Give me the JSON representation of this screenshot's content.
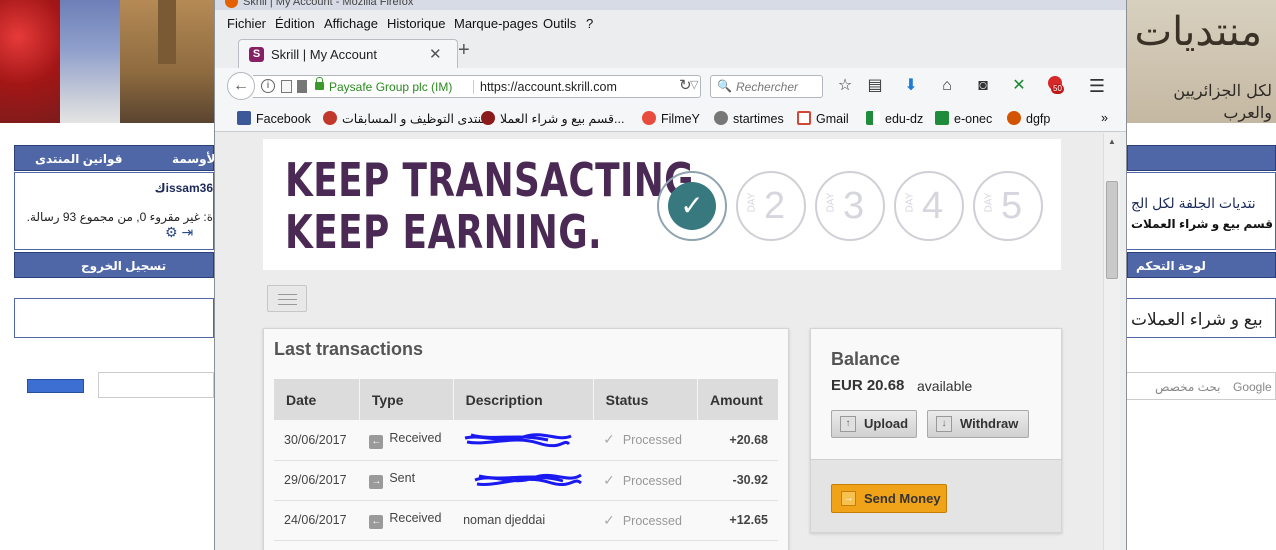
{
  "background": {
    "logo_big": "منتديات",
    "logo_small": "لكل الجزائريين والعرب",
    "forum_rules": "قوانين المنتدى",
    "medals": "الأوسمة",
    "username": "issam36",
    "welcome_prefix": "ك",
    "stats_text": "ة: غير مقروء 0, من مجموع 93 رسالة.",
    "logout": "تسجيل الخروج",
    "control_panel": "لوحة التحكم",
    "right_title": "نتديات الجلفة لكل الج",
    "right_subtitle": "قسم بيع و شراء العملات",
    "right_heading": "بيع و شراء العملات",
    "google_search": "بحث مخصص",
    "google_label": "Google"
  },
  "browser": {
    "window_title": "Skrill | My Account - Mozilla Firefox",
    "menus": [
      "Fichier",
      "Édition",
      "Affichage",
      "Historique",
      "Marque-pages",
      "Outils",
      "?"
    ],
    "tab_title": "Skrill | My Account",
    "tab_favicon": "S",
    "org": "Paysafe Group plc (IM)",
    "url": "https://account.skrill.com",
    "search_placeholder": "Rechercher",
    "badge": "50",
    "bookmarks": [
      "Facebook",
      "منتدى التوظيف و المسابقات",
      "قسم بيع و شراء العملا...",
      "FilmeY",
      "startimes",
      "Gmail",
      "edu-dz",
      "e-onec",
      "dgfp"
    ],
    "bookmark_colors": [
      "#3b5998",
      "#c0392b",
      "#8b1a1a",
      "#e74c3c",
      "#777777",
      "#d44638",
      "#1e8c3a",
      "#1e8c3a",
      "#d35400"
    ]
  },
  "promo": {
    "line1": "KEEP TRANSACTING.",
    "line2": "KEEP EARNING.",
    "day_label": "DAY",
    "days": [
      "2",
      "3",
      "4",
      "5"
    ]
  },
  "transactions": {
    "title": "Last transactions",
    "columns": [
      "Date",
      "Type",
      "Description",
      "Status",
      "Amount"
    ],
    "rows": [
      {
        "date": "30/06/2017",
        "type": "Received",
        "description": "",
        "status": "Processed",
        "amount": "+20.68"
      },
      {
        "date": "29/06/2017",
        "type": "Sent",
        "description": "",
        "status": "Processed",
        "amount": "-30.92"
      },
      {
        "date": "24/06/2017",
        "type": "Received",
        "description": "noman djeddai",
        "status": "Processed",
        "amount": "+12.65"
      }
    ]
  },
  "balance": {
    "title": "Balance",
    "amount": "EUR 20.68",
    "available": "available",
    "upload": "Upload",
    "withdraw": "Withdraw",
    "send_money": "Send Money"
  },
  "colors": {
    "skrill_purple": "#862165",
    "promo_text": "#4a2a54",
    "positive": "#3a7a2a",
    "negative": "#b02020",
    "send_button": "#f0a318",
    "scribble": "#1a1af0"
  }
}
